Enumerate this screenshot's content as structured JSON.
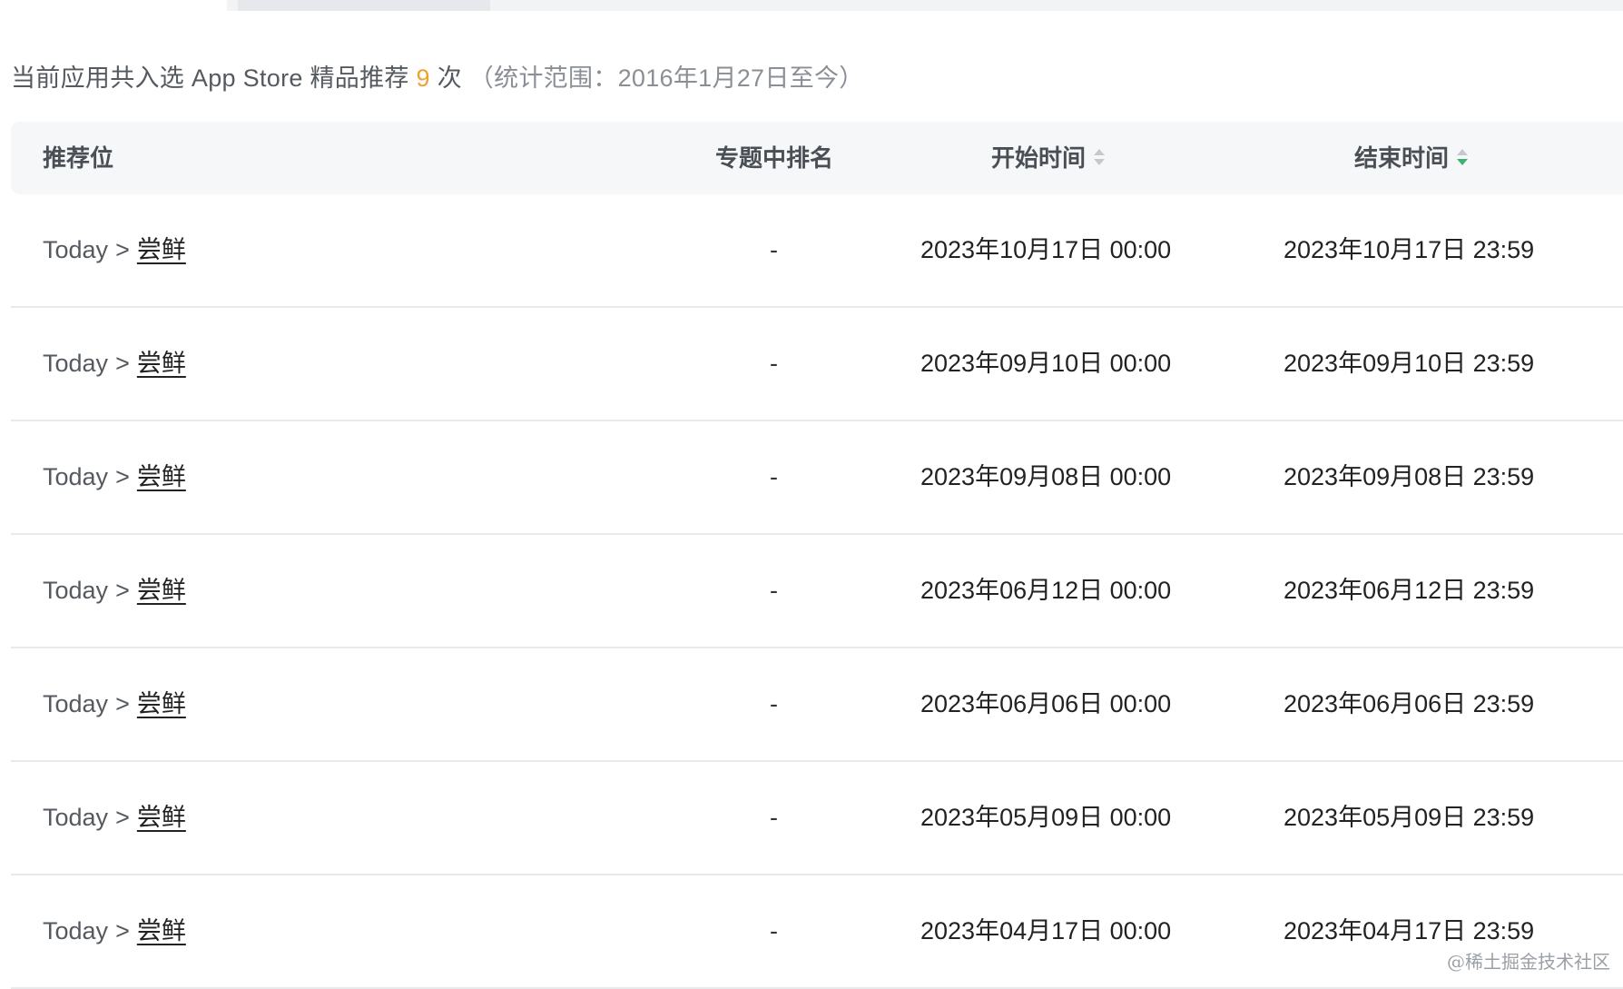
{
  "summary": {
    "prefix": "当前应用共入选 App Store 精品推荐",
    "count": "9",
    "suffix": "次",
    "range": "（统计范围：2016年1月27日至今）"
  },
  "table": {
    "headers": {
      "position": "推荐位",
      "rank": "专题中排名",
      "start": "开始时间",
      "end": "结束时间"
    },
    "sort": {
      "start": "none",
      "end": "descending"
    },
    "rows": [
      {
        "section": "Today",
        "separator": ">",
        "feature": "尝鲜",
        "rank": "-",
        "start": "2023年10月17日 00:00",
        "end": "2023年10月17日 23:59"
      },
      {
        "section": "Today",
        "separator": ">",
        "feature": "尝鲜",
        "rank": "-",
        "start": "2023年09月10日 00:00",
        "end": "2023年09月10日 23:59"
      },
      {
        "section": "Today",
        "separator": ">",
        "feature": "尝鲜",
        "rank": "-",
        "start": "2023年09月08日 00:00",
        "end": "2023年09月08日 23:59"
      },
      {
        "section": "Today",
        "separator": ">",
        "feature": "尝鲜",
        "rank": "-",
        "start": "2023年06月12日 00:00",
        "end": "2023年06月12日 23:59"
      },
      {
        "section": "Today",
        "separator": ">",
        "feature": "尝鲜",
        "rank": "-",
        "start": "2023年06月06日 00:00",
        "end": "2023年06月06日 23:59"
      },
      {
        "section": "Today",
        "separator": ">",
        "feature": "尝鲜",
        "rank": "-",
        "start": "2023年05月09日 00:00",
        "end": "2023年05月09日 23:59"
      },
      {
        "section": "Today",
        "separator": ">",
        "feature": "尝鲜",
        "rank": "-",
        "start": "2023年04月17日 00:00",
        "end": "2023年04月17日 23:59"
      }
    ]
  },
  "colors": {
    "accent_count": "#f0a02e",
    "sort_active": "#3cb371",
    "header_bg": "#f6f7f9",
    "divider": "#e8e9eb"
  },
  "watermark": "@稀土掘金技术社区"
}
